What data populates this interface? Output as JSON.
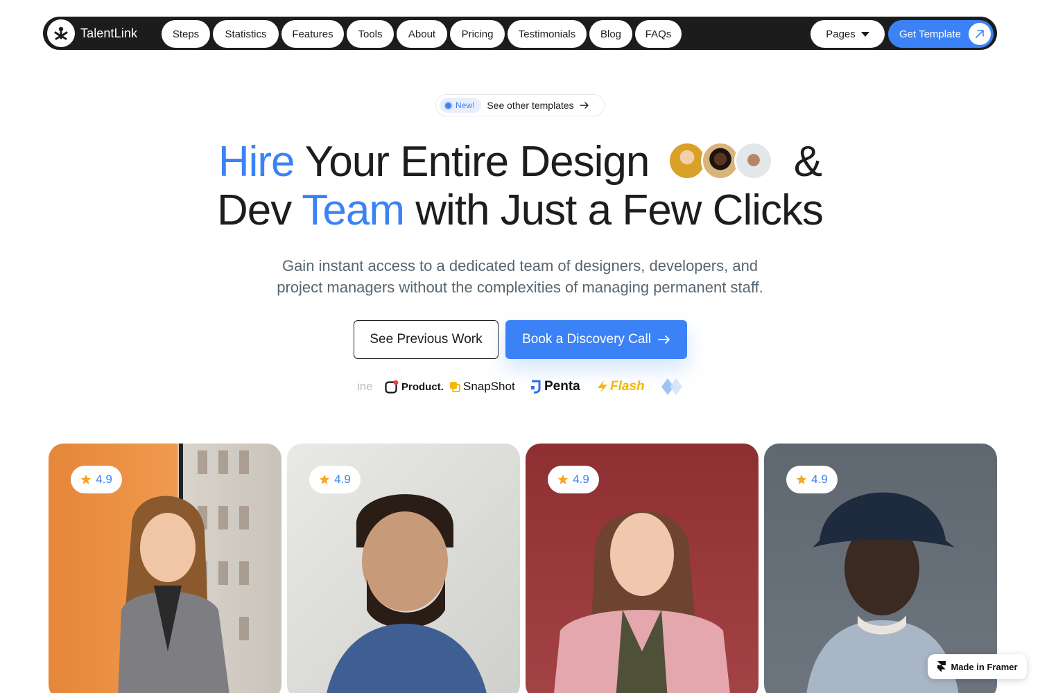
{
  "brand": {
    "name": "TalentLink"
  },
  "nav": {
    "items": [
      "Steps",
      "Statistics",
      "Features",
      "Tools",
      "About",
      "Pricing",
      "Testimonials",
      "Blog",
      "FAQs"
    ],
    "pages_label": "Pages",
    "cta_label": "Get Template"
  },
  "badge": {
    "new_label": "New!",
    "text": "See other templates"
  },
  "hero": {
    "line1_hl": "Hire",
    "line1_rest": " Your Entire Design",
    "line1_end": "&",
    "line2_start": "Dev ",
    "line2_hl": "Team",
    "line2_end": " with Just a Few Clicks",
    "subtitle_line1": "Gain instant access to a dedicated team of designers, developers, and",
    "subtitle_line2": "project managers without the complexities of managing permanent staff.",
    "secondary_button": "See Previous Work",
    "primary_button": "Book a Discovery Call"
  },
  "logos": [
    "ine",
    "Product.",
    "SnapShot",
    "Penta",
    "Flash"
  ],
  "cards": [
    {
      "rating": "4.9"
    },
    {
      "rating": "4.9"
    },
    {
      "rating": "4.9"
    },
    {
      "rating": "4.9"
    }
  ],
  "colors": {
    "accent": "#3b82f6",
    "nav_bg": "#1c1c1c",
    "text": "#1d1d1f",
    "muted": "#57656f"
  },
  "framer_badge": "Made in Framer"
}
